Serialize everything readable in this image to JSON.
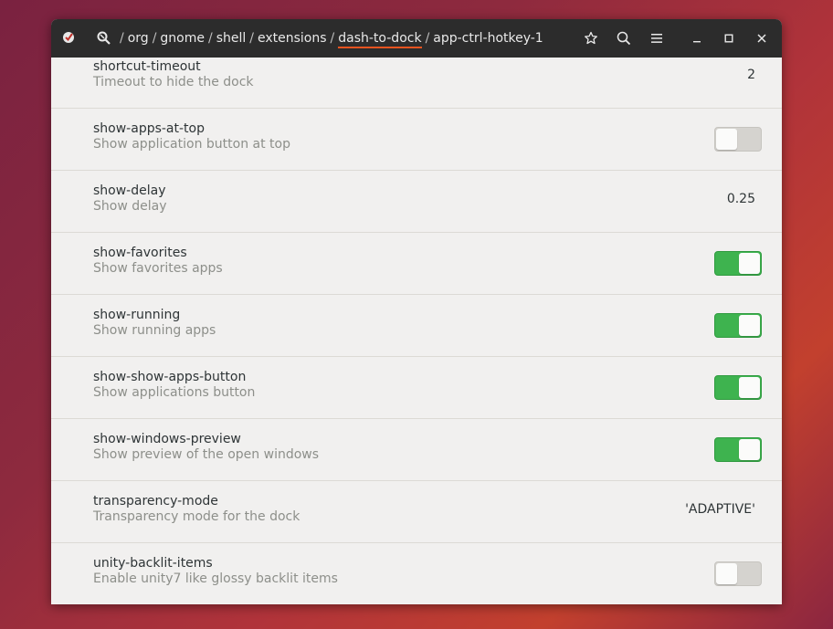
{
  "breadcrumbs": [
    "org",
    "gnome",
    "shell",
    "extensions",
    "dash-to-dock",
    "app-ctrl-hotkey-1"
  ],
  "active_crumb_index": 4,
  "accent_color": "#e95420",
  "switch_on_color": "#3eb34f",
  "header_icons": [
    "bookmark-star-icon",
    "search-icon",
    "menu-icon",
    "minimize-icon",
    "maximize-icon",
    "close-icon"
  ],
  "rows": [
    {
      "name": "shortcut-timeout",
      "desc": "Timeout to hide the dock",
      "type": "value",
      "value": "2"
    },
    {
      "name": "show-apps-at-top",
      "desc": "Show application button at top",
      "type": "switch",
      "state": false
    },
    {
      "name": "show-delay",
      "desc": "Show delay",
      "type": "value",
      "value": "0.25"
    },
    {
      "name": "show-favorites",
      "desc": "Show favorites apps",
      "type": "switch",
      "state": true
    },
    {
      "name": "show-running",
      "desc": "Show running apps",
      "type": "switch",
      "state": true
    },
    {
      "name": "show-show-apps-button",
      "desc": "Show applications button",
      "type": "switch",
      "state": true
    },
    {
      "name": "show-windows-preview",
      "desc": "Show preview of the open windows",
      "type": "switch",
      "state": true
    },
    {
      "name": "transparency-mode",
      "desc": "Transparency mode for the dock",
      "type": "value",
      "value": "'ADAPTIVE'"
    },
    {
      "name": "unity-backlit-items",
      "desc": "Enable unity7 like glossy backlit items",
      "type": "switch",
      "state": false
    }
  ]
}
